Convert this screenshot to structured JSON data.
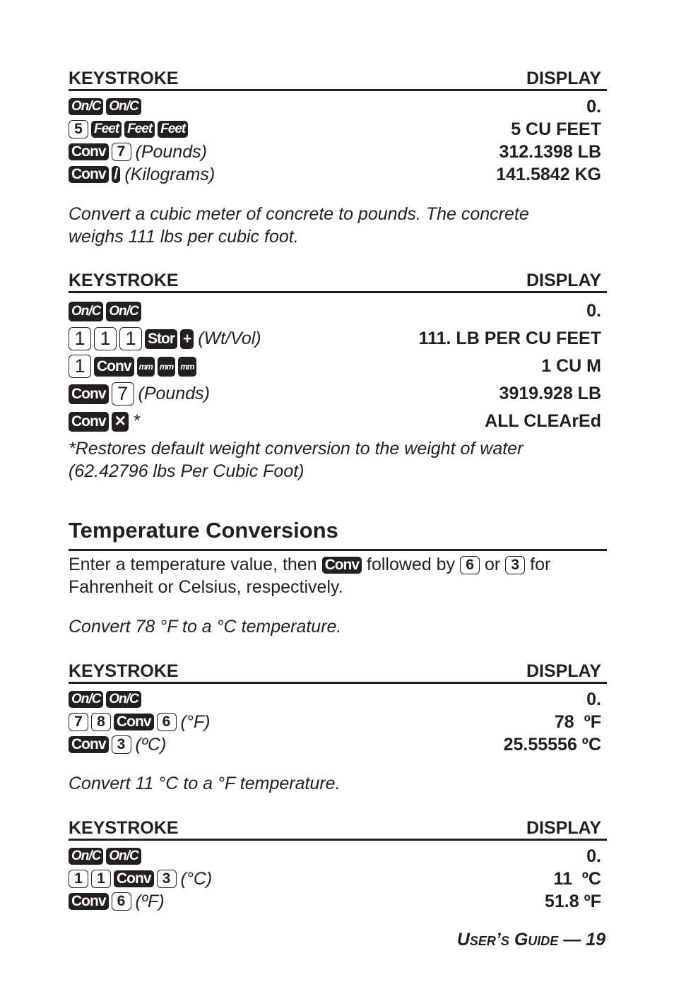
{
  "tables": [
    {
      "headers": {
        "left": "KEYSTROKE",
        "right": "DISPLAY"
      },
      "rows": [
        {
          "keys": [
            {
              "k": "On/C",
              "style": "dark-italic"
            },
            {
              "k": "On/C",
              "style": "dark-italic"
            }
          ],
          "label": "",
          "display": "0."
        },
        {
          "keys": [
            {
              "k": "5",
              "style": "light"
            },
            {
              "k": "Feet",
              "style": "dark-italic"
            },
            {
              "k": "Feet",
              "style": "dark-italic"
            },
            {
              "k": "Feet",
              "style": "dark-italic"
            }
          ],
          "label": "",
          "display": "5 CU FEET"
        },
        {
          "keys": [
            {
              "k": "Conv",
              "style": "dark"
            },
            {
              "k": "7",
              "style": "light"
            }
          ],
          "label": "(Pounds)",
          "display": "312.1398 LB"
        },
        {
          "keys": [
            {
              "k": "Conv",
              "style": "dark"
            },
            {
              "k": "/",
              "style": "dark"
            }
          ],
          "label": "(Kilograms)",
          "display": "141.5842 KG"
        }
      ]
    },
    {
      "intro": "Convert a cubic meter of concrete to pounds. The concrete weighs 111 lbs per cubic foot.",
      "headers": {
        "left": "KEYSTROKE",
        "right": "DISPLAY"
      },
      "rows": [
        {
          "keys": [
            {
              "k": "On/C",
              "style": "dark-italic"
            },
            {
              "k": "On/C",
              "style": "dark-italic"
            }
          ],
          "label": "",
          "display": "0."
        },
        {
          "keys": [
            {
              "k": "1",
              "style": "light"
            },
            {
              "k": "1",
              "style": "light"
            },
            {
              "k": "1",
              "style": "light"
            },
            {
              "k": "Stor",
              "style": "dark"
            },
            {
              "k": "+",
              "style": "dark"
            }
          ],
          "label": "(Wt/Vol)",
          "display": "111. LB PER CU FEET"
        },
        {
          "keys": [
            {
              "k": "1",
              "style": "light"
            },
            {
              "k": "Conv",
              "style": "dark"
            },
            {
              "k": "mm",
              "style": "dark-small"
            },
            {
              "k": "mm",
              "style": "dark-small"
            },
            {
              "k": "mm",
              "style": "dark-small"
            }
          ],
          "label": "",
          "display": "1 CU M"
        },
        {
          "keys": [
            {
              "k": "Conv",
              "style": "dark"
            },
            {
              "k": "7",
              "style": "light"
            }
          ],
          "label": "(Pounds)",
          "display": "3919.928 LB"
        },
        {
          "keys": [
            {
              "k": "Conv",
              "style": "dark"
            },
            {
              "k": "✕",
              "style": "dark"
            }
          ],
          "label": "*",
          "display": "ALL CLEArEd"
        }
      ],
      "footnote": "*Restores default weight conversion to the weight of water (62.42796 lbs Per Cubic Foot)"
    }
  ],
  "temperature": {
    "title": "Temperature Conversions",
    "intro_parts": [
      "Enter a temperature value, then",
      "Conv",
      "followed by",
      "6",
      "or",
      "3",
      "for Fahrenheit or Celsius, respectively."
    ],
    "examples": [
      {
        "intro": "Convert 78 °F to a °C temperature.",
        "headers": {
          "left": "KEYSTROKE",
          "right": "DISPLAY"
        },
        "rows": [
          {
            "keys": [
              {
                "k": "On/C",
                "style": "dark-italic"
              },
              {
                "k": "On/C",
                "style": "dark-italic"
              }
            ],
            "label": "",
            "display": "0."
          },
          {
            "keys": [
              {
                "k": "7",
                "style": "light"
              },
              {
                "k": "8",
                "style": "light"
              },
              {
                "k": "Conv",
                "style": "dark"
              },
              {
                "k": "6",
                "style": "light"
              }
            ],
            "label": " (°F)",
            "display": "78  ºF"
          },
          {
            "keys": [
              {
                "k": "Conv",
                "style": "dark"
              },
              {
                "k": "3",
                "style": "light"
              }
            ],
            "label": "(ºC)",
            "display": "25.55556 ºC"
          }
        ]
      },
      {
        "intro": "Convert 11 °C to a °F temperature.",
        "headers": {
          "left": "KEYSTROKE",
          "right": "DISPLAY"
        },
        "rows": [
          {
            "keys": [
              {
                "k": "On/C",
                "style": "dark-italic"
              },
              {
                "k": "On/C",
                "style": "dark-italic"
              }
            ],
            "label": "",
            "display": "0."
          },
          {
            "keys": [
              {
                "k": "1",
                "style": "light"
              },
              {
                "k": "1",
                "style": "light"
              },
              {
                "k": "Conv",
                "style": "dark"
              },
              {
                "k": "3",
                "style": "light"
              }
            ],
            "label": "(°C)",
            "display": "11  ºC"
          },
          {
            "keys": [
              {
                "k": "Conv",
                "style": "dark"
              },
              {
                "k": "6",
                "style": "light"
              }
            ],
            "label": "(ºF)",
            "display": "51.8 ºF"
          }
        ]
      }
    ]
  },
  "footer": {
    "guide": "User’s Guide",
    "dash": "—",
    "page": "19"
  }
}
